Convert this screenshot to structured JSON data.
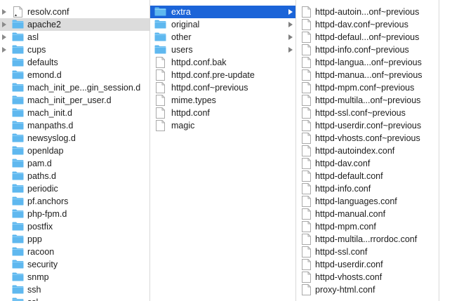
{
  "columns": [
    {
      "items": [
        {
          "name": "resolv.conf",
          "kind": "file",
          "expand": true,
          "chevron": false,
          "selected": "",
          "badge": true
        },
        {
          "name": "apache2",
          "kind": "folder",
          "expand": true,
          "chevron": false,
          "selected": "gray"
        },
        {
          "name": "asl",
          "kind": "folder",
          "expand": true,
          "chevron": false,
          "selected": ""
        },
        {
          "name": "cups",
          "kind": "folder",
          "expand": true,
          "chevron": false,
          "selected": ""
        },
        {
          "name": "defaults",
          "kind": "folder",
          "expand": false,
          "chevron": false,
          "selected": ""
        },
        {
          "name": "emond.d",
          "kind": "folder",
          "expand": false,
          "chevron": false,
          "selected": ""
        },
        {
          "name": "mach_init_pe...gin_session.d",
          "kind": "folder",
          "expand": false,
          "chevron": false,
          "selected": ""
        },
        {
          "name": "mach_init_per_user.d",
          "kind": "folder",
          "expand": false,
          "chevron": false,
          "selected": ""
        },
        {
          "name": "mach_init.d",
          "kind": "folder",
          "expand": false,
          "chevron": false,
          "selected": ""
        },
        {
          "name": "manpaths.d",
          "kind": "folder",
          "expand": false,
          "chevron": false,
          "selected": ""
        },
        {
          "name": "newsyslog.d",
          "kind": "folder",
          "expand": false,
          "chevron": false,
          "selected": ""
        },
        {
          "name": "openldap",
          "kind": "folder",
          "expand": false,
          "chevron": false,
          "selected": ""
        },
        {
          "name": "pam.d",
          "kind": "folder",
          "expand": false,
          "chevron": false,
          "selected": ""
        },
        {
          "name": "paths.d",
          "kind": "folder",
          "expand": false,
          "chevron": false,
          "selected": ""
        },
        {
          "name": "periodic",
          "kind": "folder",
          "expand": false,
          "chevron": false,
          "selected": ""
        },
        {
          "name": "pf.anchors",
          "kind": "folder",
          "expand": false,
          "chevron": false,
          "selected": ""
        },
        {
          "name": "php-fpm.d",
          "kind": "folder",
          "expand": false,
          "chevron": false,
          "selected": ""
        },
        {
          "name": "postfix",
          "kind": "folder",
          "expand": false,
          "chevron": false,
          "selected": ""
        },
        {
          "name": "ppp",
          "kind": "folder",
          "expand": false,
          "chevron": false,
          "selected": ""
        },
        {
          "name": "racoon",
          "kind": "folder",
          "expand": false,
          "chevron": false,
          "selected": ""
        },
        {
          "name": "security",
          "kind": "folder",
          "expand": false,
          "chevron": false,
          "selected": ""
        },
        {
          "name": "snmp",
          "kind": "folder",
          "expand": false,
          "chevron": false,
          "selected": ""
        },
        {
          "name": "ssh",
          "kind": "folder",
          "expand": false,
          "chevron": false,
          "selected": ""
        },
        {
          "name": "ssl",
          "kind": "folder",
          "expand": false,
          "chevron": false,
          "selected": ""
        }
      ]
    },
    {
      "items": [
        {
          "name": "extra",
          "kind": "folder",
          "expand": false,
          "chevron": true,
          "selected": "blue"
        },
        {
          "name": "original",
          "kind": "folder",
          "expand": false,
          "chevron": true,
          "selected": ""
        },
        {
          "name": "other",
          "kind": "folder",
          "expand": false,
          "chevron": true,
          "selected": ""
        },
        {
          "name": "users",
          "kind": "folder",
          "expand": false,
          "chevron": true,
          "selected": ""
        },
        {
          "name": "httpd.conf.bak",
          "kind": "file",
          "expand": false,
          "chevron": false,
          "selected": ""
        },
        {
          "name": "httpd.conf.pre-update",
          "kind": "file",
          "expand": false,
          "chevron": false,
          "selected": ""
        },
        {
          "name": "httpd.conf~previous",
          "kind": "file",
          "expand": false,
          "chevron": false,
          "selected": ""
        },
        {
          "name": "mime.types",
          "kind": "file",
          "expand": false,
          "chevron": false,
          "selected": ""
        },
        {
          "name": "httpd.conf",
          "kind": "file",
          "expand": false,
          "chevron": false,
          "selected": ""
        },
        {
          "name": "magic",
          "kind": "file",
          "expand": false,
          "chevron": false,
          "selected": ""
        }
      ]
    },
    {
      "items": [
        {
          "name": "httpd-autoin...onf~previous",
          "kind": "file",
          "expand": false,
          "chevron": false,
          "selected": ""
        },
        {
          "name": "httpd-dav.conf~previous",
          "kind": "file",
          "expand": false,
          "chevron": false,
          "selected": ""
        },
        {
          "name": "httpd-defaul...onf~previous",
          "kind": "file",
          "expand": false,
          "chevron": false,
          "selected": ""
        },
        {
          "name": "httpd-info.conf~previous",
          "kind": "file",
          "expand": false,
          "chevron": false,
          "selected": ""
        },
        {
          "name": "httpd-langua...onf~previous",
          "kind": "file",
          "expand": false,
          "chevron": false,
          "selected": ""
        },
        {
          "name": "httpd-manua...onf~previous",
          "kind": "file",
          "expand": false,
          "chevron": false,
          "selected": ""
        },
        {
          "name": "httpd-mpm.conf~previous",
          "kind": "file",
          "expand": false,
          "chevron": false,
          "selected": ""
        },
        {
          "name": "httpd-multila...onf~previous",
          "kind": "file",
          "expand": false,
          "chevron": false,
          "selected": ""
        },
        {
          "name": "httpd-ssl.conf~previous",
          "kind": "file",
          "expand": false,
          "chevron": false,
          "selected": ""
        },
        {
          "name": "httpd-userdir.conf~previous",
          "kind": "file",
          "expand": false,
          "chevron": false,
          "selected": ""
        },
        {
          "name": "httpd-vhosts.conf~previous",
          "kind": "file",
          "expand": false,
          "chevron": false,
          "selected": ""
        },
        {
          "name": "httpd-autoindex.conf",
          "kind": "file",
          "expand": false,
          "chevron": false,
          "selected": ""
        },
        {
          "name": "httpd-dav.conf",
          "kind": "file",
          "expand": false,
          "chevron": false,
          "selected": ""
        },
        {
          "name": "httpd-default.conf",
          "kind": "file",
          "expand": false,
          "chevron": false,
          "selected": ""
        },
        {
          "name": "httpd-info.conf",
          "kind": "file",
          "expand": false,
          "chevron": false,
          "selected": ""
        },
        {
          "name": "httpd-languages.conf",
          "kind": "file",
          "expand": false,
          "chevron": false,
          "selected": ""
        },
        {
          "name": "httpd-manual.conf",
          "kind": "file",
          "expand": false,
          "chevron": false,
          "selected": ""
        },
        {
          "name": "httpd-mpm.conf",
          "kind": "file",
          "expand": false,
          "chevron": false,
          "selected": ""
        },
        {
          "name": "httpd-multila...rrordoc.conf",
          "kind": "file",
          "expand": false,
          "chevron": false,
          "selected": ""
        },
        {
          "name": "httpd-ssl.conf",
          "kind": "file",
          "expand": false,
          "chevron": false,
          "selected": ""
        },
        {
          "name": "httpd-userdir.conf",
          "kind": "file",
          "expand": false,
          "chevron": false,
          "selected": ""
        },
        {
          "name": "httpd-vhosts.conf",
          "kind": "file",
          "expand": false,
          "chevron": false,
          "selected": ""
        },
        {
          "name": "proxy-html.conf",
          "kind": "file",
          "expand": false,
          "chevron": false,
          "selected": ""
        }
      ]
    }
  ],
  "colors": {
    "folder": "#5fb8ef",
    "folder_tab": "#8fd0f7",
    "selection_active": "#1b64d8",
    "selection_inactive": "#dcdcdc",
    "divider": "#d9d9d9"
  },
  "icons": {
    "folder": "folder-icon",
    "file": "document-icon",
    "expand": "disclosure-triangle-icon",
    "chevron": "chevron-right-icon"
  }
}
